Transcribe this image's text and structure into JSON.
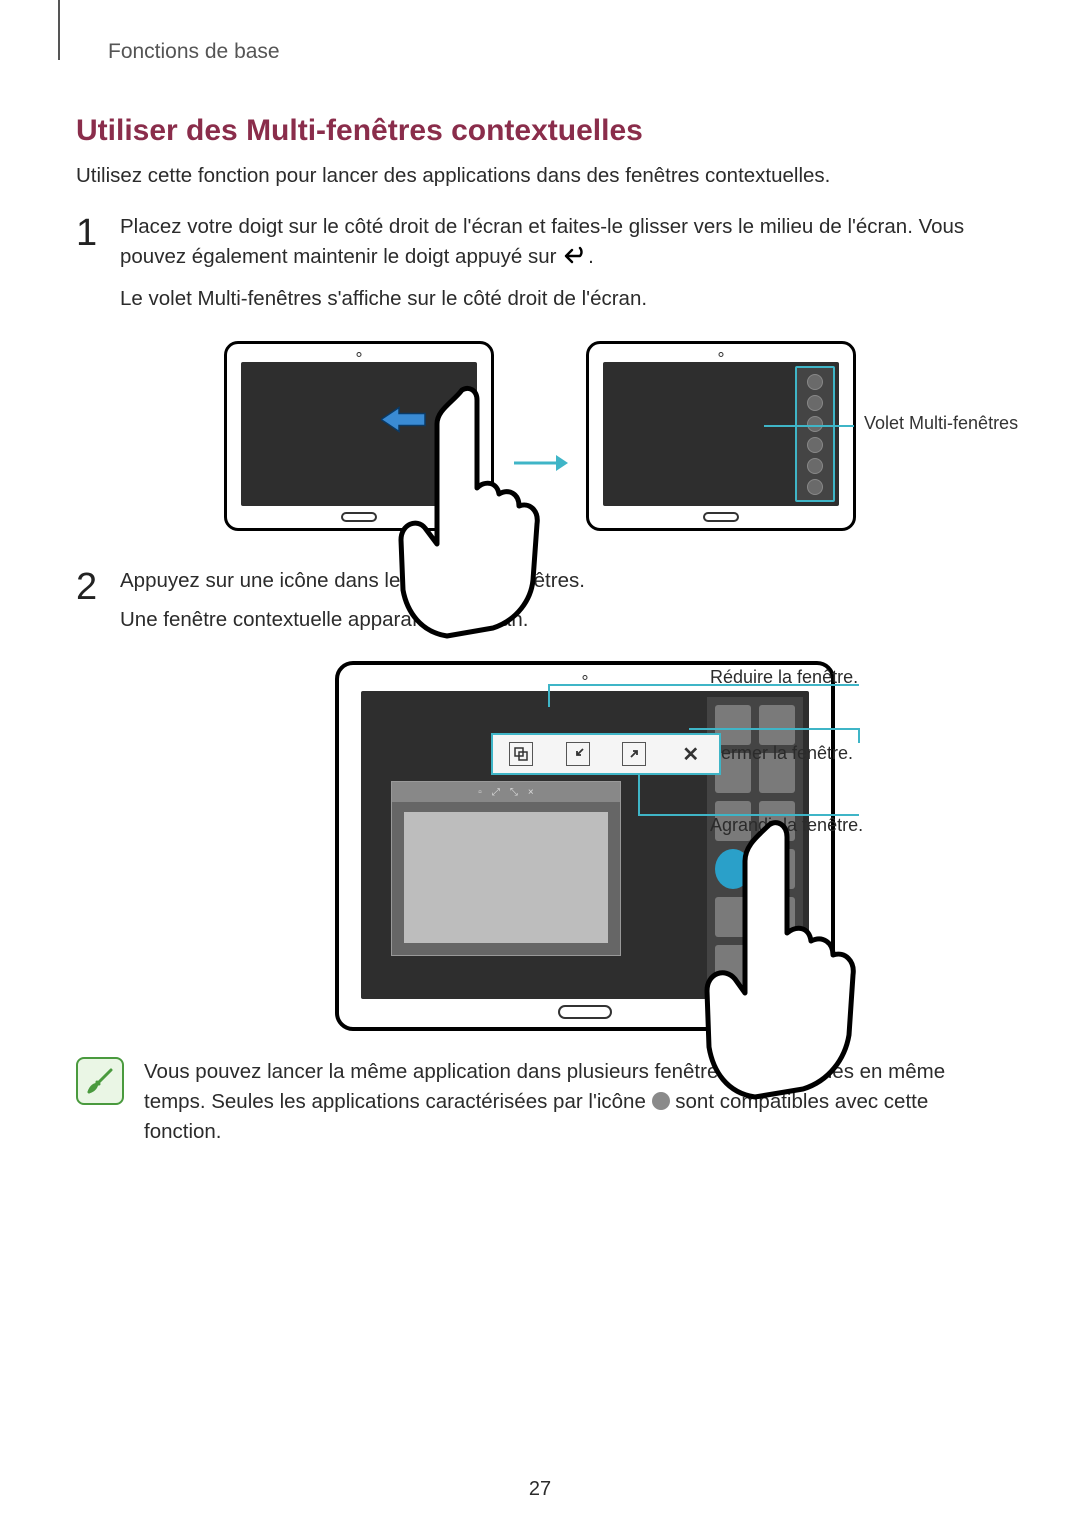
{
  "header": {
    "category": "Fonctions de base"
  },
  "title": "Utiliser des Multi-fenêtres contextuelles",
  "intro": "Utilisez cette fonction pour lancer des applications dans des fenêtres contextuelles.",
  "steps": {
    "s1": {
      "num": "1",
      "p1a": "Placez votre doigt sur le côté droit de l'écran et faites-le glisser vers le milieu de l'écran. Vous pouvez également maintenir le doigt appuyé sur ",
      "p1b": ".",
      "p2": "Le volet Multi-fenêtres s'affiche sur le côté droit de l'écran."
    },
    "s2": {
      "num": "2",
      "p1": "Appuyez sur une icône dans le volet Multi-fenêtres.",
      "p2": "Une fenêtre contextuelle apparaît sur l'écran."
    }
  },
  "fig1": {
    "callout": "Volet Multi-fenêtres"
  },
  "fig2": {
    "callouts": {
      "reduce": "Réduire la fenêtre.",
      "close": "Fermer la fenêtre.",
      "enlarge": "Agrandir la fenêtre."
    }
  },
  "note": {
    "text_a": "Vous pouvez lancer la même application dans plusieurs fenêtres contextuelles en même temps. Seules les applications caractérisées par l'icône ",
    "text_b": " sont compatibles avec cette fonction."
  },
  "page_number": "27"
}
